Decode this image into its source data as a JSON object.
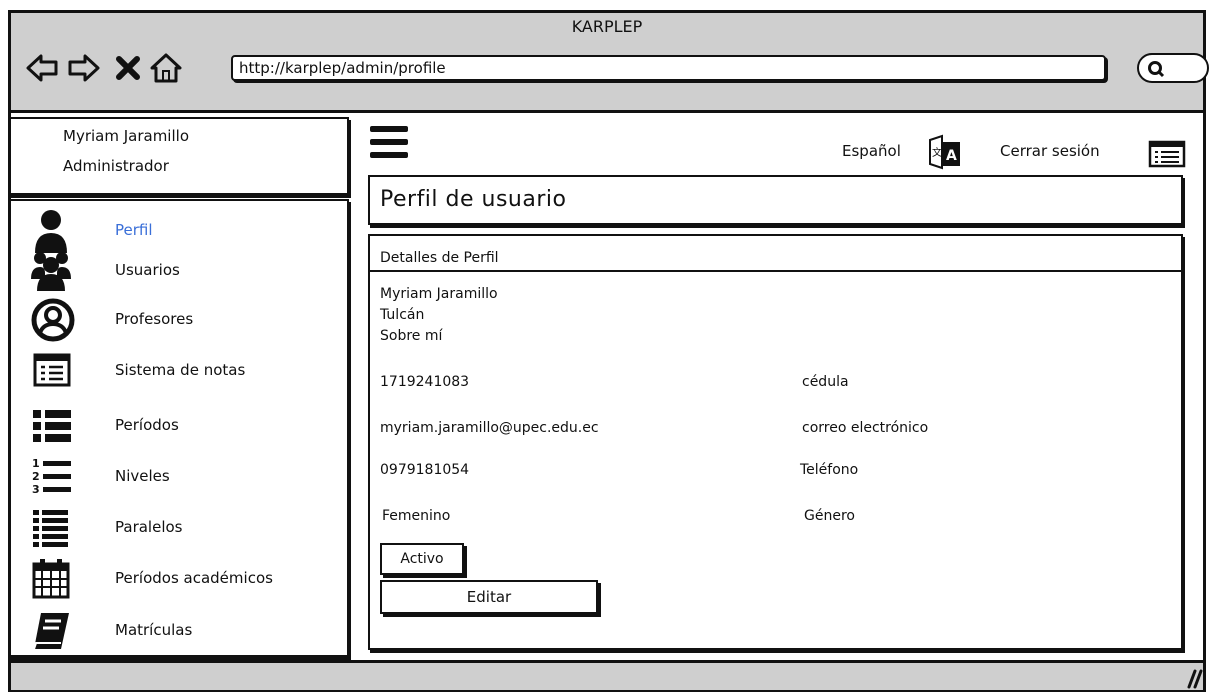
{
  "window": {
    "title": "KARPLEP"
  },
  "browser": {
    "url": "http://karplep/admin/profile",
    "nav_icons": [
      "back-arrow-icon",
      "forward-arrow-icon",
      "close-x-icon",
      "home-icon"
    ],
    "search_icon": "search-icon"
  },
  "user": {
    "name": "Myriam Jaramillo",
    "role": "Administrador"
  },
  "sidebar": {
    "items": [
      {
        "label": "Perfil",
        "icon": "user-icon",
        "active": true
      },
      {
        "label": "Usuarios",
        "icon": "users-group-icon",
        "active": false
      },
      {
        "label": "Profesores",
        "icon": "user-circle-icon",
        "active": false
      },
      {
        "label": "Sistema de notas",
        "icon": "list-box-icon",
        "active": false
      },
      {
        "label": "Períodos",
        "icon": "list-bullets-icon",
        "active": false
      },
      {
        "label": "Niveles",
        "icon": "numbered-list-icon",
        "active": false
      },
      {
        "label": "Paralelos",
        "icon": "list-lines-icon",
        "active": false
      },
      {
        "label": "Períodos académicos",
        "icon": "calendar-icon",
        "active": false
      },
      {
        "label": "Matrículas",
        "icon": "book-icon",
        "active": false
      }
    ]
  },
  "toolbar": {
    "language_label": "Español",
    "language_icon": "translate-icon",
    "logout_label": "Cerrar sesión",
    "logout_icon": "list-box-icon",
    "menu_icon": "hamburger-menu-icon"
  },
  "page": {
    "title": "Perfil de usuario"
  },
  "details": {
    "header": "Detalles de Perfil",
    "name": "Myriam Jaramillo",
    "city": "Tulcán",
    "about": "Sobre mí",
    "fields": [
      {
        "value": "1719241083",
        "label": "cédula"
      },
      {
        "value": "myriam.jaramillo@upec.edu.ec",
        "label": "correo electrónico"
      },
      {
        "value": "0979181054",
        "label": "Teléfono"
      },
      {
        "value": "Femenino",
        "label": "Género"
      }
    ],
    "status_button": "Activo",
    "edit_button": "Editar"
  },
  "colors": {
    "active_link": "#3a6fd8",
    "chrome_gray": "#cfcfcf",
    "ink": "#111111"
  }
}
